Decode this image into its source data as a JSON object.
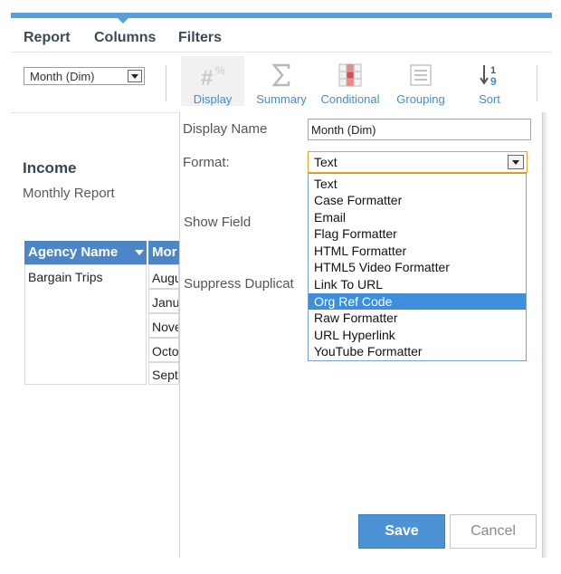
{
  "tabs": [
    "Report",
    "Columns",
    "Filters"
  ],
  "column_select": {
    "value": "Month (Dim)"
  },
  "toolbar": {
    "display": "Display",
    "summary": "Summary",
    "conditional": "Conditional",
    "grouping": "Grouping",
    "sort": "Sort",
    "sort_icon_digits": [
      "1",
      "9"
    ]
  },
  "report": {
    "title": "Income",
    "subtitle": "Monthly Report",
    "columns": [
      "Agency Name",
      "Mor"
    ],
    "agency_value": "Bargain Trips",
    "months": [
      "Augu",
      "Janu",
      "Nove",
      "Octo",
      "Sept"
    ]
  },
  "panel": {
    "display_name_label": "Display Name",
    "display_name_value": "Month (Dim)",
    "format_label": "Format:",
    "format_value": "Text",
    "show_field_label": "Show Field",
    "suppress_label": "Suppress Duplicat",
    "format_options": [
      "Text",
      "Case Formatter",
      "Email",
      "Flag Formatter",
      "HTML Formatter",
      "HTML5 Video Formatter",
      "Link To URL",
      "Org Ref Code",
      "Raw Formatter",
      "URL Hyperlink",
      "YouTube Formatter"
    ],
    "highlighted_option": "Org Ref Code",
    "save": "Save",
    "cancel": "Cancel"
  },
  "colors": {
    "accent": "#5aa0d6",
    "header_blue": "#4c86c6",
    "highlight": "#3e8ede",
    "focus_border": "#e4a32a"
  }
}
